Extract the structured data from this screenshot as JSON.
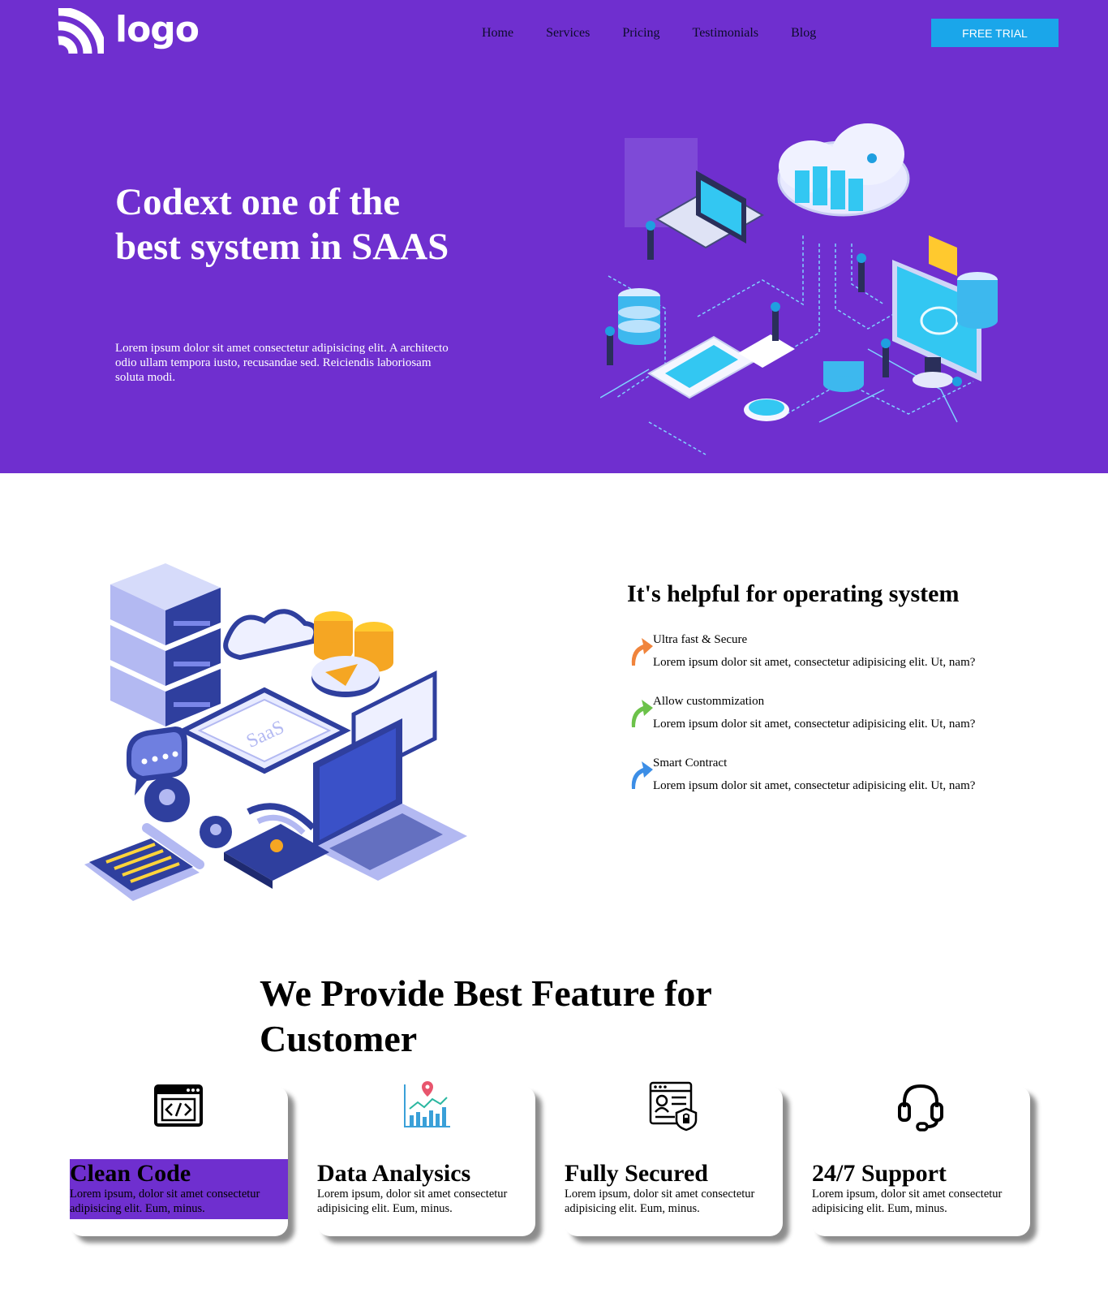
{
  "brand": {
    "logo_text": "logo",
    "accent": "#6f2fcf",
    "button_color": "#1aa6ea"
  },
  "nav": {
    "items": [
      {
        "label": "Home"
      },
      {
        "label": "Services"
      },
      {
        "label": "Pricing"
      },
      {
        "label": "Testimonials"
      },
      {
        "label": "Blog"
      }
    ],
    "cta": "FREE TRIAL"
  },
  "hero": {
    "title": "Codext one of the best system in SAAS",
    "description": "Lorem ipsum dolor sit amet consectetur adipisicing elit. A architecto odio ullam tempora iusto, recusandae sed. Reiciendis laboriosam soluta modi."
  },
  "helpful": {
    "title": "It's helpful for operating system",
    "items": [
      {
        "name": "Ultra fast & Secure",
        "desc": "Lorem ipsum dolor sit amet, consectetur adipisicing elit. Ut, nam?",
        "arrow_color": "#f0843c"
      },
      {
        "name": "Allow custommization",
        "desc": "Lorem ipsum dolor sit amet, consectetur adipisicing elit. Ut, nam?",
        "arrow_color": "#6cc24a"
      },
      {
        "name": "Smart Contract",
        "desc": "Lorem ipsum dolor sit amet, consectetur adipisicing elit. Ut, nam?",
        "arrow_color": "#3c8ee6"
      }
    ]
  },
  "features": {
    "title": "We Provide Best Feature for Customer",
    "cards": [
      {
        "title": "Clean Code",
        "desc": "Lorem ipsum, dolor sit amet consectetur adipisicing elit. Eum, minus.",
        "icon": "code-window-icon"
      },
      {
        "title": "Data Analysics",
        "desc": "Lorem ipsum, dolor sit amet consectetur adipisicing elit. Eum, minus.",
        "icon": "analytics-chart-icon"
      },
      {
        "title": "Fully Secured",
        "desc": "Lorem ipsum, dolor sit amet consectetur adipisicing elit. Eum, minus.",
        "icon": "secure-profile-icon"
      },
      {
        "title": "24/7 Support",
        "desc": "Lorem ipsum, dolor sit amet consectetur adipisicing elit. Eum, minus.",
        "icon": "headset-icon"
      }
    ]
  }
}
